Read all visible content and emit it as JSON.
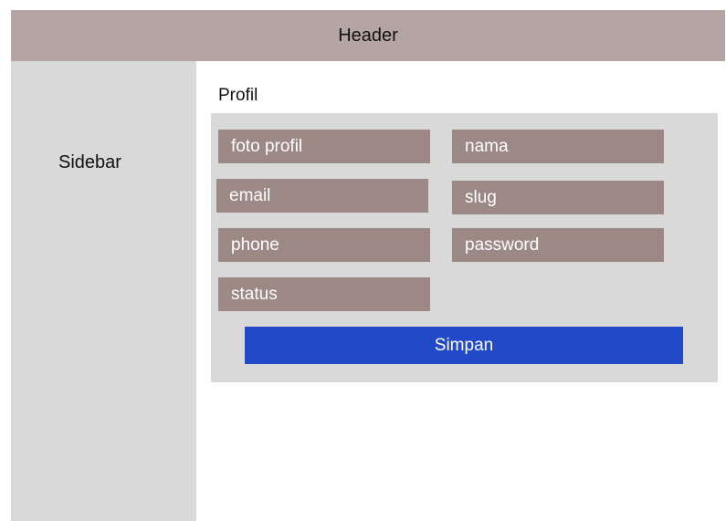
{
  "header": {
    "title": "Header"
  },
  "sidebar": {
    "label": "Sidebar"
  },
  "main": {
    "title": "Profil",
    "fields": {
      "photo": "foto profil",
      "name": "nama",
      "email": "email",
      "slug": "slug",
      "phone": "phone",
      "password": "password",
      "status": "status"
    },
    "save_label": "Simpan"
  },
  "colors": {
    "header_bg": "#b4a5a3",
    "panel_bg": "#d9d9d9",
    "field_bg": "#9c8986",
    "button_bg": "#2249c7"
  }
}
